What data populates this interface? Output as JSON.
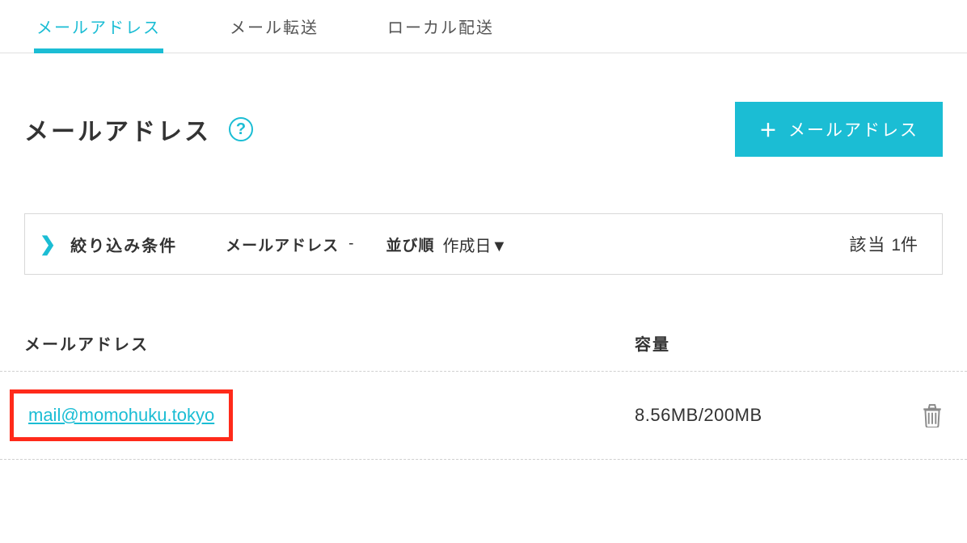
{
  "tabs": [
    {
      "label": "メールアドレス",
      "active": true
    },
    {
      "label": "メール転送",
      "active": false
    },
    {
      "label": "ローカル配送",
      "active": false
    }
  ],
  "page_title": "メールアドレス",
  "help_symbol": "?",
  "add_button": {
    "plus": "＋",
    "label": "メールアドレス"
  },
  "filter": {
    "title": "絞り込み条件",
    "field_label": "メールアドレス",
    "field_value": "-",
    "sort_label": "並び順",
    "sort_value": "作成日▼",
    "count_label": "該当",
    "count_value": "1件"
  },
  "columns": {
    "email": "メールアドレス",
    "capacity": "容量"
  },
  "rows": [
    {
      "email": "mail@momohuku.tokyo",
      "capacity": "8.56MB/200MB"
    }
  ]
}
